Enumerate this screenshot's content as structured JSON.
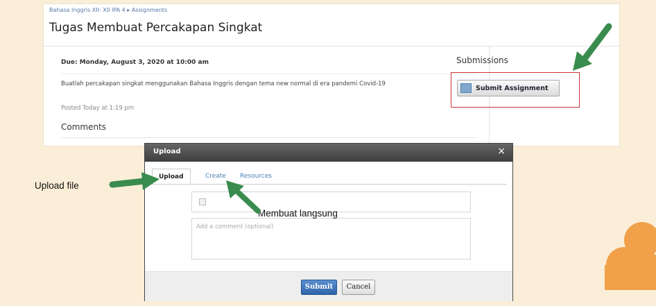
{
  "top_strip": {
    "text": "· · · · · · · · · · · · · · · · · · · · · · ·"
  },
  "page": {
    "breadcrumb": "Bahasa Inggris XII: XII IPA 4 ▸ Assignments",
    "title": "Tugas Membuat Percakapan Singkat",
    "due": "Due: Monday, August 3, 2020 at 10:00 am",
    "description": "Buatlah percakapan singkat menggunakan Bahasa Inggris dengan tema new normal di era pandemi Covid-19",
    "posted": "Posted Today at 1:19 pm",
    "comments_heading": "Comments",
    "submissions_heading": "Submissions",
    "submit_assignment_label": "Submit Assignment"
  },
  "modal": {
    "title": "Upload",
    "close_symbol": "×",
    "tabs": [
      {
        "label": "Upload",
        "active": true
      },
      {
        "label": "Create",
        "active": false
      },
      {
        "label": "Resources",
        "active": false
      }
    ],
    "comment_placeholder": "Add a comment (optional)",
    "submit_label": "Submit",
    "cancel_label": "Cancel"
  },
  "annotations": {
    "upload_file": "Upload file",
    "membuat_langsung": "Membuat langsung"
  },
  "colors": {
    "background": "#fbeed8",
    "arrow_green": "#3a8c4e",
    "highlight_red": "#cc3333",
    "link_blue": "#4a80b8",
    "cloud_orange": "#f0a14a"
  },
  "icons": [
    "doc-icon",
    "close-icon",
    "checkbox-icon",
    "arrow-icon",
    "cloud-icon"
  ]
}
